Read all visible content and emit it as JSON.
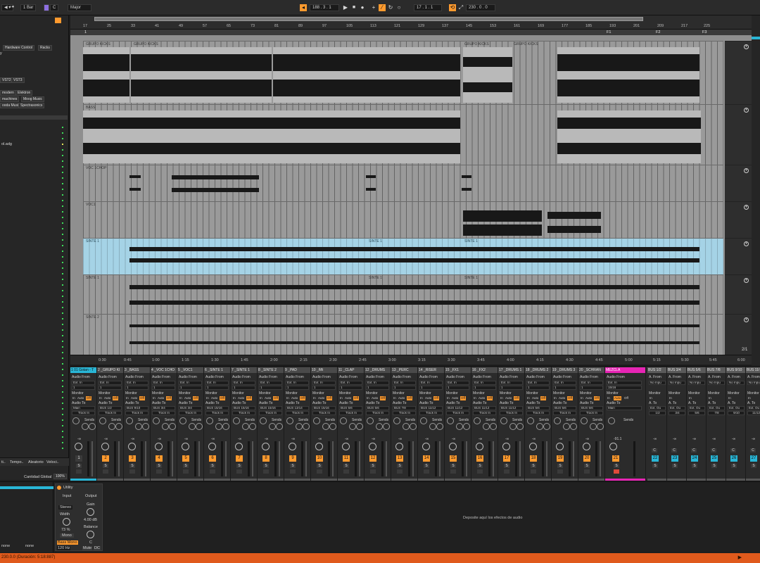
{
  "topbar": {
    "quantize": "1 Bar",
    "key_root": "C",
    "key_scale": "Major",
    "position": "188 . 3 . 1",
    "loop_start": "17 . 1 . 1",
    "loop_length": "230 . 0 . 0"
  },
  "browser": {
    "items": [
      "Hardware Control",
      "Racks",
      "VST2",
      "VST3",
      "modern",
      "Elektron",
      "machines",
      "Moog Music",
      "ooda Music",
      "Spectrasonics"
    ],
    "file_item": "ol.adg",
    "tabs": [
      "ti..",
      "Tempo..",
      "Aleatorio",
      "Veloci.."
    ],
    "global_label": "Cantidad Global",
    "global_value": "100%",
    "bottom_values": [
      "none",
      "none"
    ]
  },
  "arrangement": {
    "bar_numbers": [
      "17",
      "25",
      "33",
      "41",
      "49",
      "57",
      "65",
      "73",
      "81",
      "89",
      "97",
      "105",
      "113",
      "121",
      "129",
      "137",
      "145",
      "153",
      "161",
      "169",
      "177",
      "185",
      "193",
      "201",
      "209",
      "217",
      "225"
    ],
    "locators": [
      "1",
      "F1",
      "F2",
      "F3"
    ],
    "clips": [
      "GRUPO KICKS",
      "GRUPO KICKS",
      "GRUPO KICKS",
      "GRUPO KICKS",
      "BASS",
      "VOC 1CHOP",
      "VOC1",
      "SINTE 1",
      "SINTE 1",
      "SINTE 1",
      "SINTE 1",
      "SINTE 1",
      "SINTE 1",
      "SINTE 2"
    ],
    "times": [
      "0:30",
      "0:45",
      "1:00",
      "1:15",
      "1:30",
      "1:45",
      "2:00",
      "2:15",
      "2:30",
      "2:45",
      "3:00",
      "3:15",
      "3:30",
      "3:45",
      "4:00",
      "4:15",
      "4:30",
      "4:45",
      "5:00",
      "5:15",
      "5:30",
      "5:45",
      "6:00"
    ],
    "page": "2/1"
  },
  "mixer": {
    "channels": [
      {
        "name": "1 01 Gotan - T",
        "num": "1",
        "route_to": "Main"
      },
      {
        "name": "2 _GRUPO KI",
        "num": "2",
        "route_to": "BUS 1/2"
      },
      {
        "name": "3 _BASS",
        "num": "3",
        "route_to": "BUS 9/10"
      },
      {
        "name": "4 _VOC 1CHO",
        "num": "4",
        "route_to": "BUS 3/4"
      },
      {
        "name": "5 _VOC1",
        "num": "5",
        "route_to": "BUS 3/4"
      },
      {
        "name": "6 _SINTE 1",
        "num": "6",
        "route_to": "BUS 15/16"
      },
      {
        "name": "7 _SINTE 1",
        "num": "7",
        "route_to": "BUS 15/16"
      },
      {
        "name": "8 _SINTE 2",
        "num": "8",
        "route_to": "BUS 15/16"
      },
      {
        "name": "9 _PAD",
        "num": "9",
        "route_to": "BUS 13/14"
      },
      {
        "name": "10 _ññi",
        "num": "10",
        "route_to": "BUS 15/16"
      },
      {
        "name": "11 _CLAP",
        "num": "11",
        "route_to": "BUS 5/6"
      },
      {
        "name": "12 _DRUMS",
        "num": "12",
        "route_to": "BUS 5/6"
      },
      {
        "name": "13 _PERC",
        "num": "13",
        "route_to": "BUS 7/8"
      },
      {
        "name": "14 _RISER",
        "num": "14",
        "route_to": "BUS 11/12"
      },
      {
        "name": "15 _FX1",
        "num": "15",
        "route_to": "BUS 11/12"
      },
      {
        "name": "16 _FX2",
        "num": "16",
        "route_to": "BUS 11/12"
      },
      {
        "name": "17 _DRUMS 1",
        "num": "17",
        "route_to": "BUS 11/12"
      },
      {
        "name": "18 _DRUMS 2",
        "num": "18",
        "route_to": "BUS 5/6"
      },
      {
        "name": "19 _DRUMS 3",
        "num": "19",
        "route_to": "BUS 5/6"
      },
      {
        "name": "20 _SCHRAN",
        "num": "20",
        "route_to": "BUS 5/6"
      }
    ],
    "master": {
      "name": "MEZCLA",
      "num": "21",
      "input": "15/16",
      "route_to": "Main",
      "volume": "-91.1"
    },
    "buses": [
      {
        "name": "BUS 1/2",
        "num": "22",
        "input": "No Inpu",
        "route_to": "1/2"
      },
      {
        "name": "BUS 3/4",
        "num": "23",
        "input": "No Inpu",
        "route_to": "3/4"
      },
      {
        "name": "BUS 5/6",
        "num": "24",
        "input": "No Inpu",
        "route_to": "5/6"
      },
      {
        "name": "BUS 7/8",
        "num": "25",
        "input": "No Inpu",
        "route_to": "7/8"
      },
      {
        "name": "BUS 9/10",
        "num": "26",
        "input": "No Inpu",
        "route_to": "9/10"
      },
      {
        "name": "BUS 11/",
        "num": "27",
        "input": "No Inpu",
        "route_to": "11/12"
      }
    ],
    "labels": {
      "audio_from": "Audio From",
      "ext_in": "Ext. In",
      "one": "1",
      "monitor": "Monitor",
      "in": "In",
      "auto": "Auto",
      "off": "Off",
      "audio_to": "Audio To",
      "track_in": "Track In",
      "sends": "Sends",
      "neg_inf": "-∞",
      "a_from": "A. From",
      "a_to": "A. To",
      "ext_out": "Ext. Ou",
      "s": "S",
      "c": "C"
    }
  },
  "device": {
    "title": "Utility",
    "input": "Input",
    "output": "Output",
    "stereo": "Stereo",
    "width_label": "Width",
    "width_value": "73 %",
    "mono": "Mono",
    "bass_mono": "Bass Mono",
    "bass_freq": "120 Hz",
    "gain_label": "Gain",
    "gain_value": "4.00 dB",
    "balance_label": "Balance",
    "balance_value": "C",
    "mute": "Mute",
    "dc": "DC",
    "drop_hint": "Deposite aquí los efectos de audio"
  },
  "status": {
    "text": "230.0.0 (Duración: 5:18:887)"
  }
}
